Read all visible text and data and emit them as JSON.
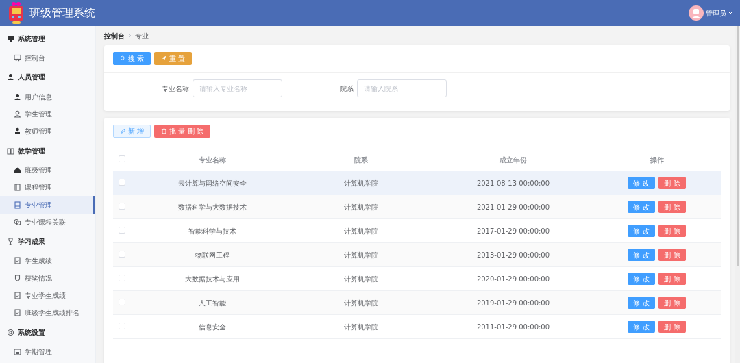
{
  "header": {
    "title": "班级管理系统",
    "user": "管理员"
  },
  "sidebar": {
    "groups": [
      {
        "label": "系统管理",
        "items": [
          {
            "label": "控制台",
            "selected": false
          }
        ]
      },
      {
        "label": "人员管理",
        "items": [
          {
            "label": "用户信息",
            "selected": false
          },
          {
            "label": "学生管理",
            "selected": false
          },
          {
            "label": "教师管理",
            "selected": false
          }
        ]
      },
      {
        "label": "教学管理",
        "items": [
          {
            "label": "班级管理",
            "selected": false
          },
          {
            "label": "课程管理",
            "selected": false
          },
          {
            "label": "专业管理",
            "selected": true
          },
          {
            "label": "专业课程关联",
            "selected": false
          }
        ]
      },
      {
        "label": "学习成果",
        "items": [
          {
            "label": "学生成绩",
            "selected": false
          },
          {
            "label": "获奖情况",
            "selected": false
          },
          {
            "label": "专业学生成绩",
            "selected": false
          },
          {
            "label": "班级学生成绩排名",
            "selected": false
          }
        ]
      },
      {
        "label": "系统设置",
        "items": [
          {
            "label": "学期管理",
            "selected": false
          }
        ]
      }
    ]
  },
  "breadcrumb": [
    "控制台",
    "专业"
  ],
  "search_panel": {
    "buttons": [
      "搜 索",
      "重 置"
    ],
    "fields": [
      {
        "label": "专业名称",
        "placeholder": "请输入专业名称"
      },
      {
        "label": "院系",
        "placeholder": "请输入院系"
      }
    ]
  },
  "toolbar": {
    "buttons": [
      "新 增",
      "批 量 删 除"
    ]
  },
  "table": {
    "columns": [
      "专业名称",
      "院系",
      "成立年份",
      "操作"
    ],
    "header_checked": false,
    "rows": [
      {
        "checked": false,
        "highlighted": true,
        "cells": [
          "云计算与网络空间安全",
          "计算机学院",
          "2021-08-13 00:00:00"
        ],
        "actions": [
          "修 改",
          "删 除"
        ]
      },
      {
        "checked": false,
        "highlighted": false,
        "cells": [
          "数据科学与大数据技术",
          "计算机学院",
          "2021-01-29 00:00:00"
        ],
        "actions": [
          "修 改",
          "删 除"
        ]
      },
      {
        "checked": false,
        "highlighted": false,
        "cells": [
          "智能科学与技术",
          "计算机学院",
          "2017-01-29 00:00:00"
        ],
        "actions": [
          "修 改",
          "删 除"
        ]
      },
      {
        "checked": false,
        "highlighted": false,
        "cells": [
          "物联网工程",
          "计算机学院",
          "2013-01-29 00:00:00"
        ],
        "actions": [
          "修 改",
          "删 除"
        ]
      },
      {
        "checked": false,
        "highlighted": false,
        "cells": [
          "大数据技术与应用",
          "计算机学院",
          "2020-01-29 00:00:00"
        ],
        "actions": [
          "修 改",
          "删 除"
        ]
      },
      {
        "checked": false,
        "highlighted": false,
        "cells": [
          "人工智能",
          "计算机学院",
          "2019-01-29 00:00:00"
        ],
        "actions": [
          "修 改",
          "删 除"
        ]
      },
      {
        "checked": false,
        "highlighted": false,
        "cells": [
          "信息安全",
          "计算机学院",
          "2011-01-29 00:00:00"
        ],
        "actions": [
          "修 改",
          "删 除"
        ]
      }
    ]
  }
}
